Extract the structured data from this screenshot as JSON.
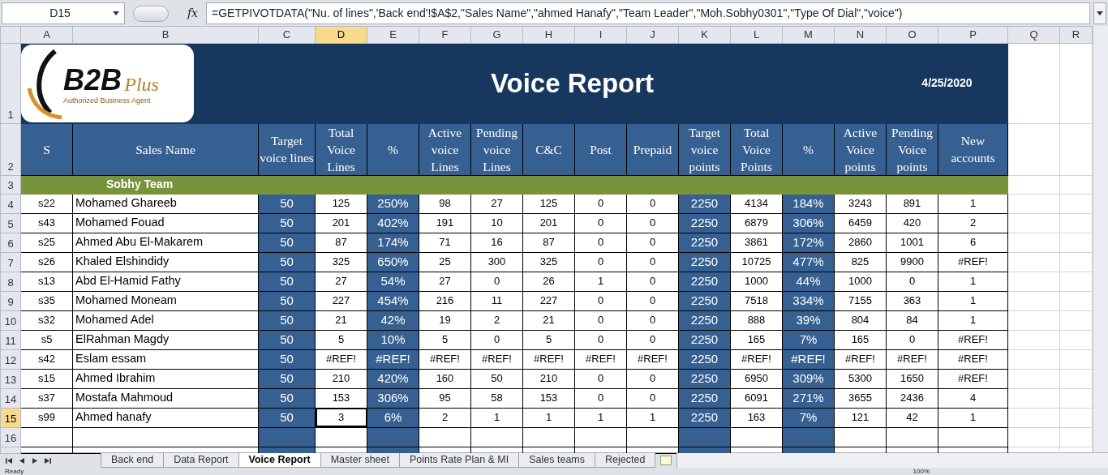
{
  "formula_bar": {
    "name_box": "D15",
    "fx_label": "fx",
    "formula": "=GETPIVOTDATA(\"Nu. of lines\",'Back end'!$A$2,\"Sales Name\",\"ahmed Hanafy\",\"Team Leader\",\"Moh.Sobhy0301\",\"Type Of Dial\",\"voice\")"
  },
  "columns": [
    {
      "label": "A",
      "selected": false,
      "shaded": false
    },
    {
      "label": "B",
      "selected": false,
      "shaded": false
    },
    {
      "label": "C",
      "selected": false,
      "shaded": true
    },
    {
      "label": "D",
      "selected": true,
      "shaded": false
    },
    {
      "label": "E",
      "selected": false,
      "shaded": true
    },
    {
      "label": "F",
      "selected": false,
      "shaded": false
    },
    {
      "label": "G",
      "selected": false,
      "shaded": false
    },
    {
      "label": "H",
      "selected": false,
      "shaded": false
    },
    {
      "label": "I",
      "selected": false,
      "shaded": false
    },
    {
      "label": "J",
      "selected": false,
      "shaded": false
    },
    {
      "label": "K",
      "selected": false,
      "shaded": true
    },
    {
      "label": "L",
      "selected": false,
      "shaded": false
    },
    {
      "label": "M",
      "selected": false,
      "shaded": true
    },
    {
      "label": "N",
      "selected": false,
      "shaded": false
    },
    {
      "label": "O",
      "selected": false,
      "shaded": false
    },
    {
      "label": "P",
      "selected": false,
      "shaded": false
    },
    {
      "label": "Q",
      "selected": false,
      "shaded": false
    },
    {
      "label": "R",
      "selected": false,
      "shaded": false
    }
  ],
  "banner": {
    "row": "1",
    "logo": {
      "mark": "B2B",
      "suffix": "Plus",
      "tagline": "Authorized Business Agent"
    },
    "title": "Voice Report",
    "date": "4/25/2020"
  },
  "header": {
    "row": "2",
    "labels": [
      "S",
      "Sales Name",
      "Target voice lines",
      "Total Voice Lines",
      "%",
      "Active voice Lines",
      "Pending voice Lines",
      "C&C",
      "Post",
      "Prepaid",
      "Target voice points",
      "Total Voice Points",
      "%",
      "Active Voice points",
      "Pending Voice points",
      "New accounts"
    ]
  },
  "team": {
    "row": "3",
    "label": "Sobhy Team"
  },
  "rows": [
    {
      "row": "4",
      "selected": false,
      "cells": [
        "s22",
        "Mohamed Ghareeb",
        "50",
        "125",
        "250%",
        "98",
        "27",
        "125",
        "0",
        "0",
        "2250",
        "4134",
        "184%",
        "3243",
        "891",
        "1"
      ]
    },
    {
      "row": "5",
      "selected": false,
      "cells": [
        "s43",
        "Mohamed Fouad",
        "50",
        "201",
        "402%",
        "191",
        "10",
        "201",
        "0",
        "0",
        "2250",
        "6879",
        "306%",
        "6459",
        "420",
        "2"
      ]
    },
    {
      "row": "6",
      "selected": false,
      "cells": [
        "s25",
        "Ahmed Abu El-Makarem",
        "50",
        "87",
        "174%",
        "71",
        "16",
        "87",
        "0",
        "0",
        "2250",
        "3861",
        "172%",
        "2860",
        "1001",
        "6"
      ]
    },
    {
      "row": "7",
      "selected": false,
      "cells": [
        "s26",
        "Khaled Elshindidy",
        "50",
        "325",
        "650%",
        "25",
        "300",
        "325",
        "0",
        "0",
        "2250",
        "10725",
        "477%",
        "825",
        "9900",
        "#REF!"
      ]
    },
    {
      "row": "8",
      "selected": false,
      "cells": [
        "s13",
        "Abd El-Hamid Fathy",
        "50",
        "27",
        "54%",
        "27",
        "0",
        "26",
        "1",
        "0",
        "2250",
        "1000",
        "44%",
        "1000",
        "0",
        "1"
      ]
    },
    {
      "row": "9",
      "selected": false,
      "cells": [
        "s35",
        "Mohamed Moneam",
        "50",
        "227",
        "454%",
        "216",
        "11",
        "227",
        "0",
        "0",
        "2250",
        "7518",
        "334%",
        "7155",
        "363",
        "1"
      ]
    },
    {
      "row": "10",
      "selected": false,
      "cells": [
        "s32",
        "Mohamed Adel",
        "50",
        "21",
        "42%",
        "19",
        "2",
        "21",
        "0",
        "0",
        "2250",
        "888",
        "39%",
        "804",
        "84",
        "1"
      ]
    },
    {
      "row": "11",
      "selected": false,
      "cells": [
        "s5",
        "ElRahman Magdy",
        "50",
        "5",
        "10%",
        "5",
        "0",
        "5",
        "0",
        "0",
        "2250",
        "165",
        "7%",
        "165",
        "0",
        "#REF!"
      ]
    },
    {
      "row": "12",
      "selected": false,
      "cells": [
        "s42",
        "Eslam essam",
        "50",
        "#REF!",
        "#REF!",
        "#REF!",
        "#REF!",
        "#REF!",
        "#REF!",
        "#REF!",
        "2250",
        "#REF!",
        "#REF!",
        "#REF!",
        "#REF!",
        "#REF!"
      ]
    },
    {
      "row": "13",
      "selected": false,
      "cells": [
        "s15",
        "Ahmed Ibrahim",
        "50",
        "210",
        "420%",
        "160",
        "50",
        "210",
        "0",
        "0",
        "2250",
        "6950",
        "309%",
        "5300",
        "1650",
        "#REF!"
      ]
    },
    {
      "row": "14",
      "selected": false,
      "cells": [
        "s37",
        "Mostafa Mahmoud",
        "50",
        "153",
        "306%",
        "95",
        "58",
        "153",
        "0",
        "0",
        "2250",
        "6091",
        "271%",
        "3655",
        "2436",
        "4"
      ]
    },
    {
      "row": "15",
      "selected": true,
      "cells": [
        "s99",
        "Ahmed hanafy",
        "50",
        "3",
        "6%",
        "2",
        "1",
        "1",
        "1",
        "1",
        "2250",
        "163",
        "7%",
        "121",
        "42",
        "1"
      ]
    }
  ],
  "empty_rows": [
    "16"
  ],
  "sheet_tabs": [
    {
      "label": "Back end",
      "selected": false
    },
    {
      "label": "Data Report",
      "selected": false
    },
    {
      "label": "Voice Report",
      "selected": true
    },
    {
      "label": "Master sheet",
      "selected": false
    },
    {
      "label": "Points Rate Plan & MI",
      "selected": false
    },
    {
      "label": "Sales teams",
      "selected": false
    },
    {
      "label": "Rejected",
      "selected": false
    }
  ],
  "status_bar": {
    "mode": "Ready",
    "zoom": "100%"
  }
}
